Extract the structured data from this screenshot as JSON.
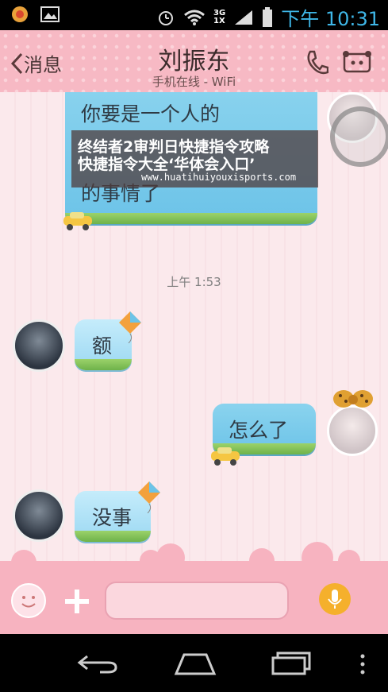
{
  "status_bar": {
    "time": "下午 10:31",
    "network": [
      "3G",
      "1X"
    ],
    "icons": [
      "app-notification-icon",
      "gallery-icon",
      "alarm-icon",
      "wifi-icon",
      "signal-icon",
      "battery-icon"
    ]
  },
  "header": {
    "back_label": "消息",
    "contact_name": "刘振东",
    "contact_status": "手机在线 - WiFi",
    "actions": [
      "phone-icon",
      "profile-card-icon"
    ]
  },
  "overlay": {
    "line1": "终结者2审判日快捷指令攻略",
    "line2": "快捷指令大全‘华体会入口’",
    "line3": "www.huatihuiyouxisports.com"
  },
  "messages": [
    {
      "side": "right",
      "text_line1": "你要是一个人的",
      "text_line3": "的事情了"
    },
    {
      "side": "left",
      "text": "额"
    },
    {
      "side": "right",
      "text": "怎么了"
    },
    {
      "side": "left",
      "text": "没事"
    }
  ],
  "timestamp": "上午 1:53",
  "input": {
    "placeholder": "",
    "emoji_icon": "smiley-icon",
    "plus_icon": "plus-icon",
    "mic_icon": "microphone-icon"
  },
  "colors": {
    "header_pink": "#f7b9c4",
    "chat_bg": "#fbe9ec",
    "bubble_blue": "#8ad3ee",
    "status_time": "#3fb7e8",
    "mic_orange": "#f5b02c"
  }
}
